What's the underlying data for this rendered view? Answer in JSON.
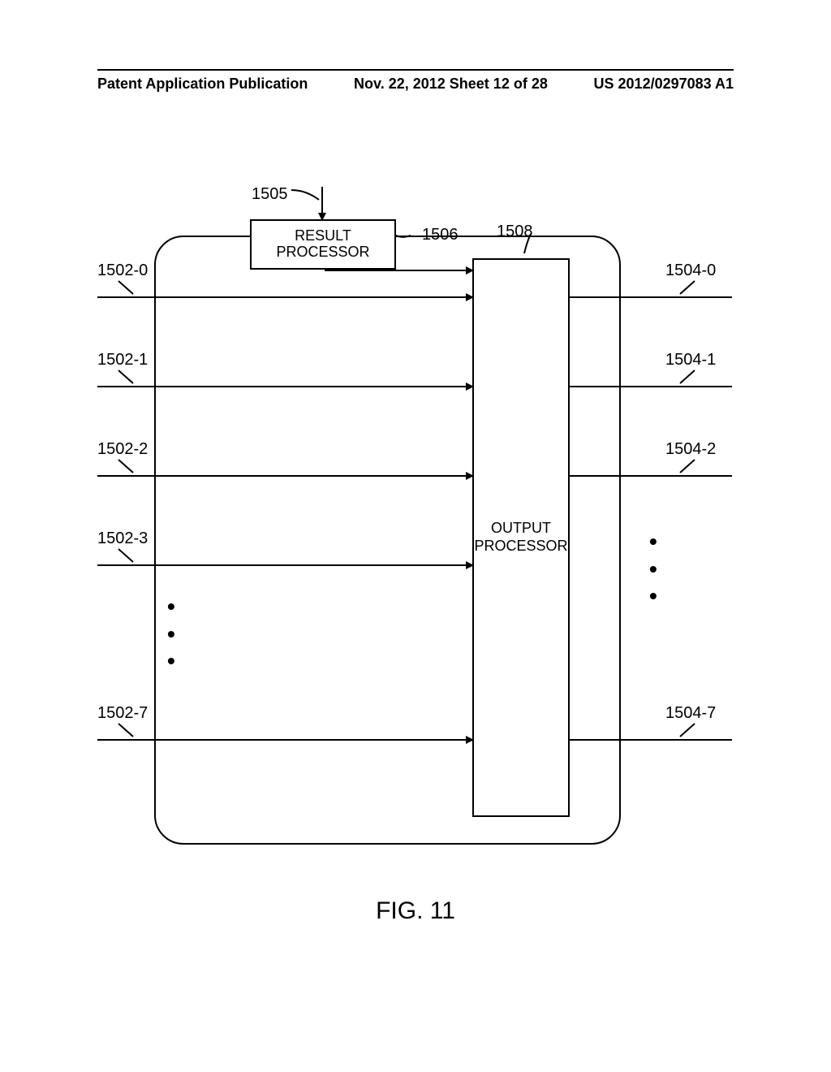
{
  "header": {
    "left": "Patent Application Publication",
    "center": "Nov. 22, 2012  Sheet 12 of 28",
    "right": "US 2012/0297083 A1"
  },
  "labels": {
    "ref_1505": "1505",
    "ref_1506": "1506",
    "ref_1508": "1508",
    "result_processor": "RESULT PROCESSOR",
    "output_processor": "OUTPUT PROCESSOR",
    "in_0": "1502-0",
    "in_1": "1502-1",
    "in_2": "1502-2",
    "in_3": "1502-3",
    "in_7": "1502-7",
    "out_0": "1504-0",
    "out_1": "1504-1",
    "out_2": "1504-2",
    "out_7": "1504-7"
  },
  "caption": "FIG. 11",
  "chart_data": {
    "type": "diagram",
    "title": "FIG. 11",
    "components": [
      {
        "id": "1505",
        "role": "input-signal",
        "target": "1506"
      },
      {
        "id": "1506",
        "role": "block",
        "name": "RESULT PROCESSOR"
      },
      {
        "id": "1508",
        "role": "block",
        "name": "OUTPUT PROCESSOR"
      },
      {
        "id": "1502-0",
        "role": "input-line",
        "target": "1508"
      },
      {
        "id": "1502-1",
        "role": "input-line",
        "target": "1508"
      },
      {
        "id": "1502-2",
        "role": "input-line",
        "target": "1508"
      },
      {
        "id": "1502-3",
        "role": "input-line",
        "target": "1508"
      },
      {
        "id": "1502-7",
        "role": "input-line",
        "target": "1508"
      },
      {
        "id": "1504-0",
        "role": "output-line",
        "source": "1508"
      },
      {
        "id": "1504-1",
        "role": "output-line",
        "source": "1508"
      },
      {
        "id": "1504-2",
        "role": "output-line",
        "source": "1508"
      },
      {
        "id": "1504-7",
        "role": "output-line",
        "source": "1508"
      }
    ],
    "connections": [
      {
        "from": "1505",
        "to": "1506"
      },
      {
        "from": "1506",
        "to": "1508"
      },
      {
        "from": "1502-0",
        "to": "1508"
      },
      {
        "from": "1502-1",
        "to": "1508"
      },
      {
        "from": "1502-2",
        "to": "1508"
      },
      {
        "from": "1502-3",
        "to": "1508"
      },
      {
        "from": "1502-7",
        "to": "1508"
      },
      {
        "from": "1508",
        "to": "1504-0"
      },
      {
        "from": "1508",
        "to": "1504-1"
      },
      {
        "from": "1508",
        "to": "1504-2"
      },
      {
        "from": "1508",
        "to": "1504-7"
      }
    ],
    "notes": "Inputs 1502-0..1502-7 (eight total, ellipsis between 1502-3 and 1502-7) feed OUTPUT PROCESSOR 1508. RESULT PROCESSOR 1506 receives signal 1505 and feeds 1508. Outputs 1504-0..1504-7 (eight total, ellipsis between 1504-2 and 1504-7) exit 1508."
  }
}
